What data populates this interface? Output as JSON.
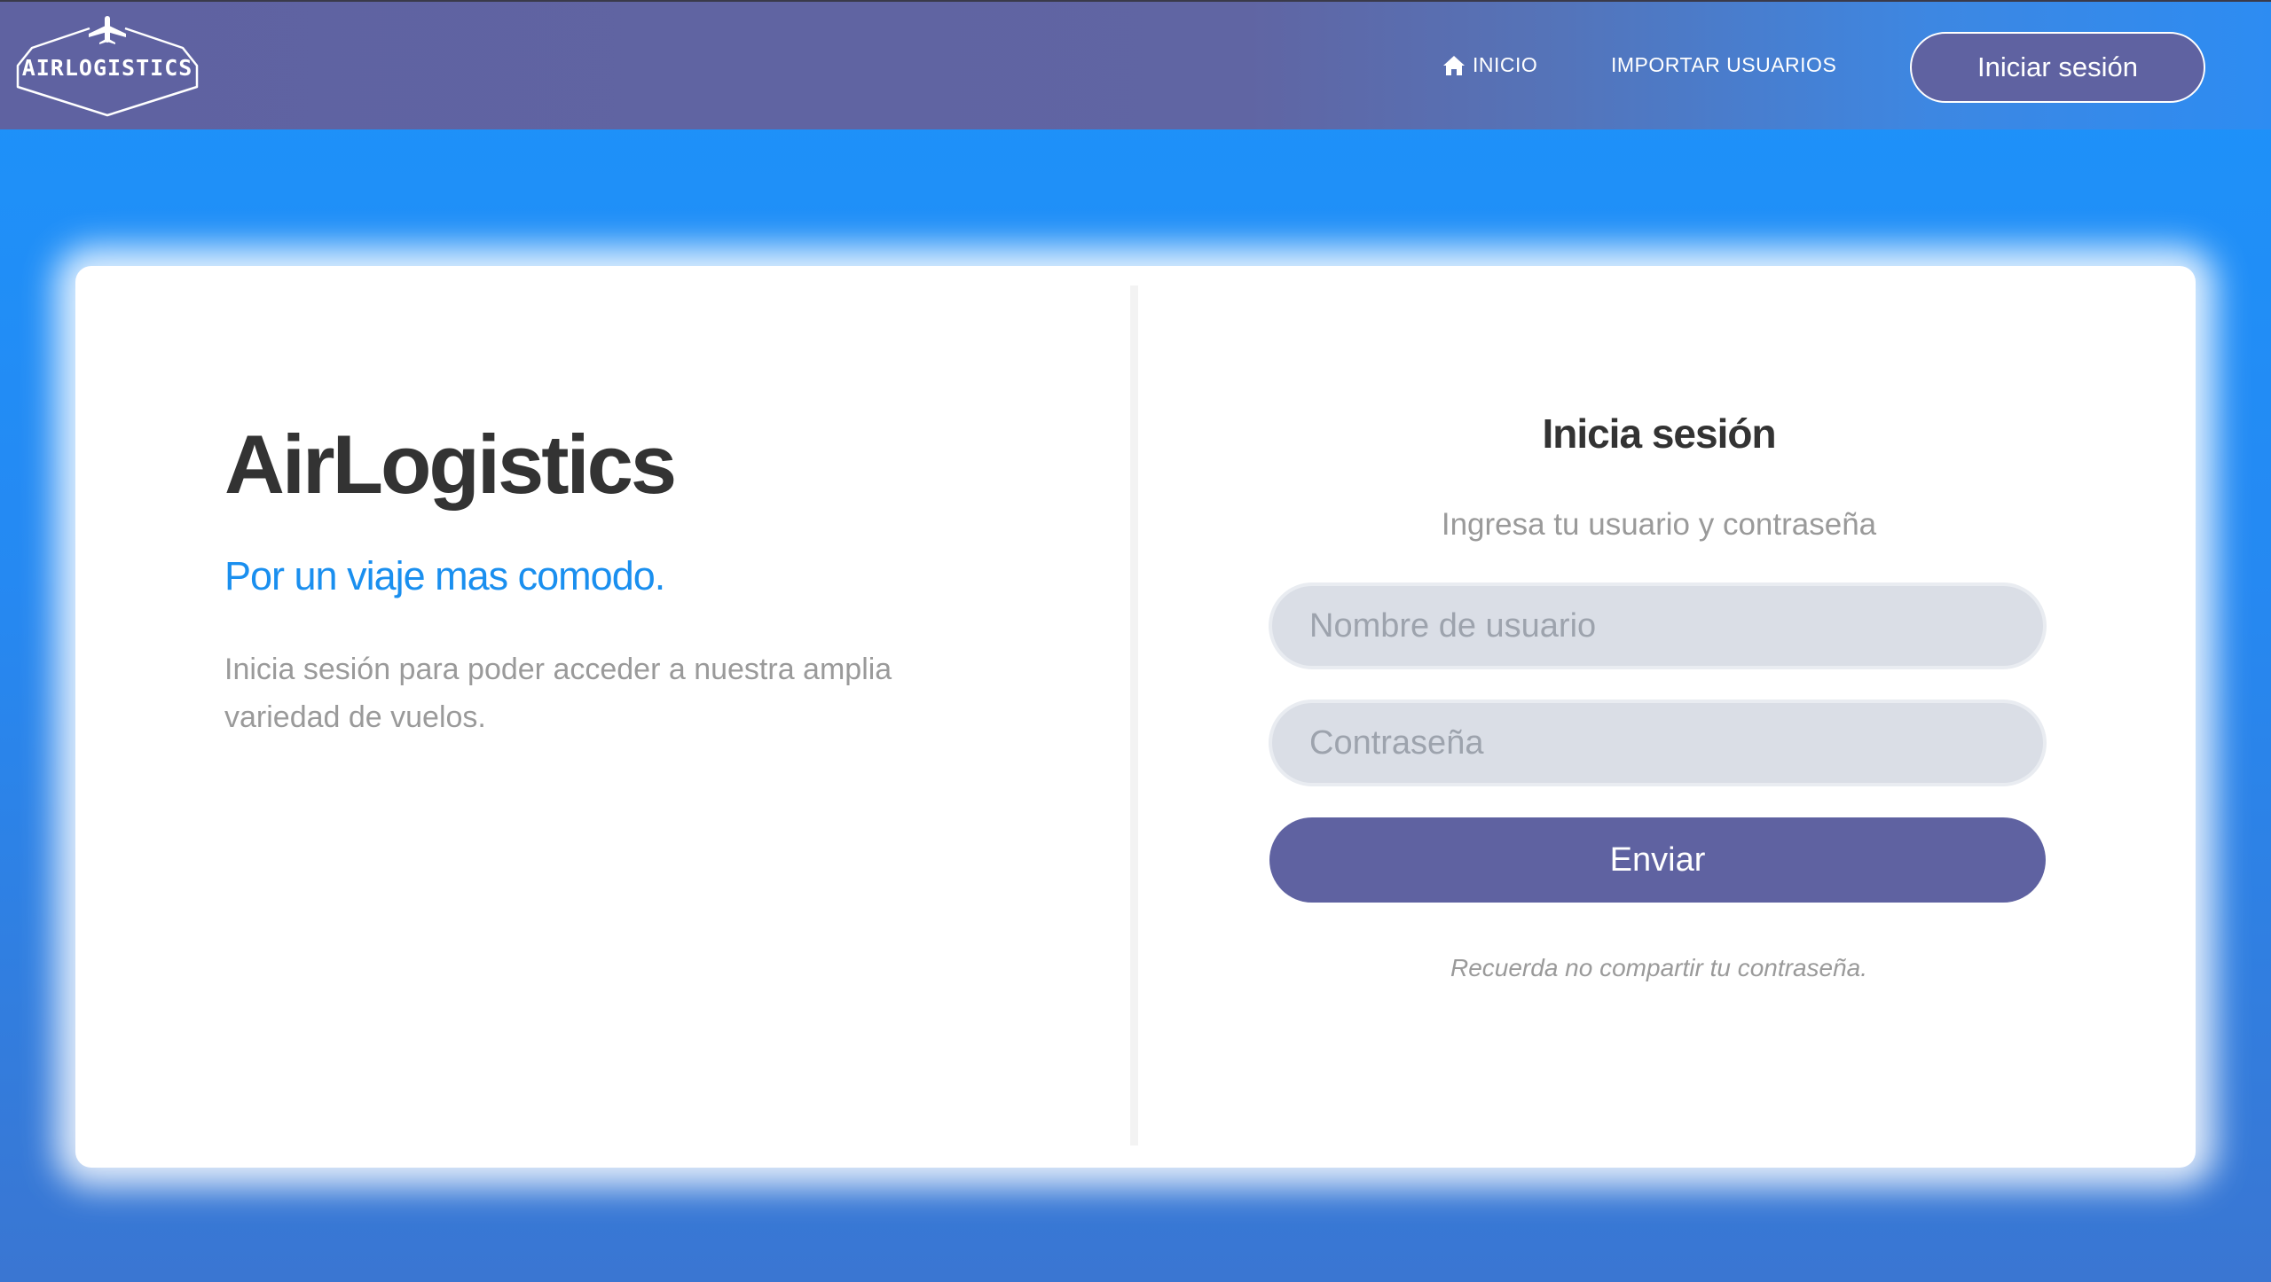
{
  "navbar": {
    "logo_text": "AIRLOGISTICS",
    "links": [
      {
        "label": "INICIO",
        "icon": "home-icon"
      },
      {
        "label": "IMPORTAR USUARIOS"
      }
    ],
    "login_button": "Iniciar sesión"
  },
  "hero": {
    "title": "AirLogistics",
    "tagline": "Por un viaje mas comodo.",
    "description": "Inicia sesión para poder acceder a nuestra amplia variedad de vuelos."
  },
  "login_form": {
    "title": "Inicia sesión",
    "subtitle": "Ingresa tu usuario y contraseña",
    "username_placeholder": "Nombre de usuario",
    "password_placeholder": "Contraseña",
    "submit_label": "Enviar",
    "note": "Recuerda no compartir tu contraseña."
  },
  "colors": {
    "accent": "#5f62a1",
    "brand_blue": "#1a8fef",
    "background_blue": "#1c93fb"
  }
}
